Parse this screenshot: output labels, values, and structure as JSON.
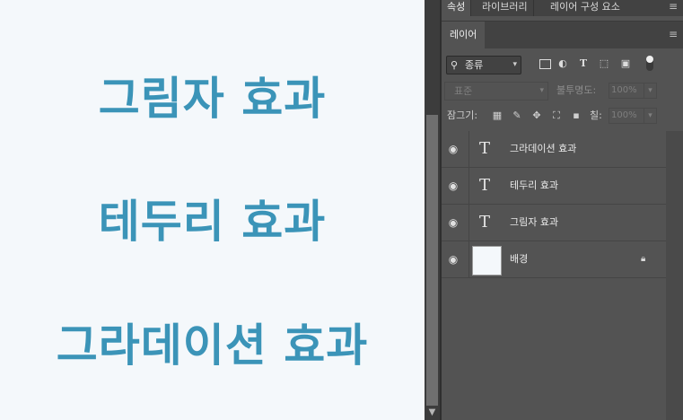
{
  "canvas": {
    "texts": [
      "그림자 효과",
      "테두리 효과",
      "그라데이션 효과"
    ],
    "text_color": "#3b94b8",
    "background": "#f4f8fb"
  },
  "tabs_top": [
    "속성",
    "라이브러리",
    "레이어 구성 요소"
  ],
  "layers_panel": {
    "tab": "레이어",
    "filter": {
      "kind": "종류"
    },
    "blend_mode": "표준",
    "opacity_label": "불투명도:",
    "opacity_value": "100%",
    "lock_label": "잠그기:",
    "fill_label": "칠:",
    "fill_value": "100%",
    "layers": [
      {
        "name": "그라데이션 효과",
        "type": "text",
        "visible": true
      },
      {
        "name": "테두리 효과",
        "type": "text",
        "visible": true
      },
      {
        "name": "그림자 효과",
        "type": "text",
        "visible": true
      },
      {
        "name": "배경",
        "type": "background",
        "visible": true,
        "locked": true
      }
    ]
  },
  "icons": {
    "menu": "≡",
    "search": "🔍",
    "chevron": "⌄",
    "eye": "👁",
    "text_layer": "T",
    "lock": "🔒"
  },
  "colors": {
    "panel_bg": "#535353",
    "panel_dark": "#424242",
    "accent_text": "#3b94b8"
  }
}
